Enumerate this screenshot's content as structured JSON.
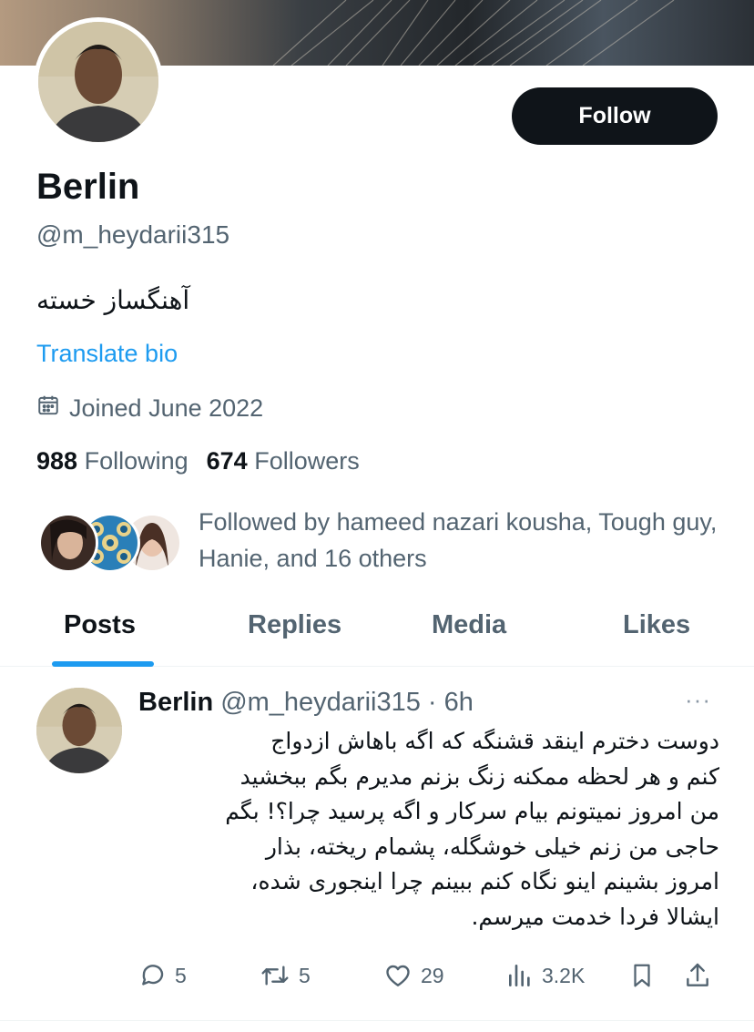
{
  "profile": {
    "display_name": "Berlin",
    "handle": "@m_heydarii315",
    "bio": "آهنگساز خسته",
    "translate_label": "Translate bio",
    "joined": "Joined June 2022",
    "following_count": "988",
    "following_label": "Following",
    "followers_count": "674",
    "followers_label": "Followers",
    "followed_by": "Followed by hameed nazari kousha, Tough guy, Hanie, and 16 others",
    "follow_label": "Follow"
  },
  "tabs": [
    {
      "label": "Posts",
      "active": true
    },
    {
      "label": "Replies",
      "active": false
    },
    {
      "label": "Media",
      "active": false
    },
    {
      "label": "Likes",
      "active": false
    }
  ],
  "post": {
    "author": "Berlin",
    "handle_time": "@m_heydarii315 · 6h",
    "more": "···",
    "lines": [
      "دوست دخترم اینقد قشنگه که اگه  باهاش ازدواج",
      "کنم و هر لحظه ممکنه زنگ بزنم مدیرم بگم ببخشید",
      "من امروز نمیتونم بیام سرکار و اگه پرسید چرا؟! بگم",
      "حاجی من زنم خیلی خوشگله، پشمام ریخته، بذار",
      "امروز بشینم اینو نگاه کنم ببینم چرا اینجوری شده،",
      "ایشالا فردا خدمت میرسم."
    ],
    "replies": "5",
    "reposts": "5",
    "likes": "29",
    "views": "3.2K"
  },
  "icons": {
    "calendar": "calendar-icon",
    "reply": "reply-icon",
    "repost": "repost-icon",
    "like": "heart-icon",
    "views": "views-icon",
    "bookmark": "bookmark-icon",
    "share": "share-icon"
  },
  "colors": {
    "accent": "#1d9bf0",
    "text": "#0f1419",
    "secondary": "#536471",
    "button": "#0f1419"
  }
}
